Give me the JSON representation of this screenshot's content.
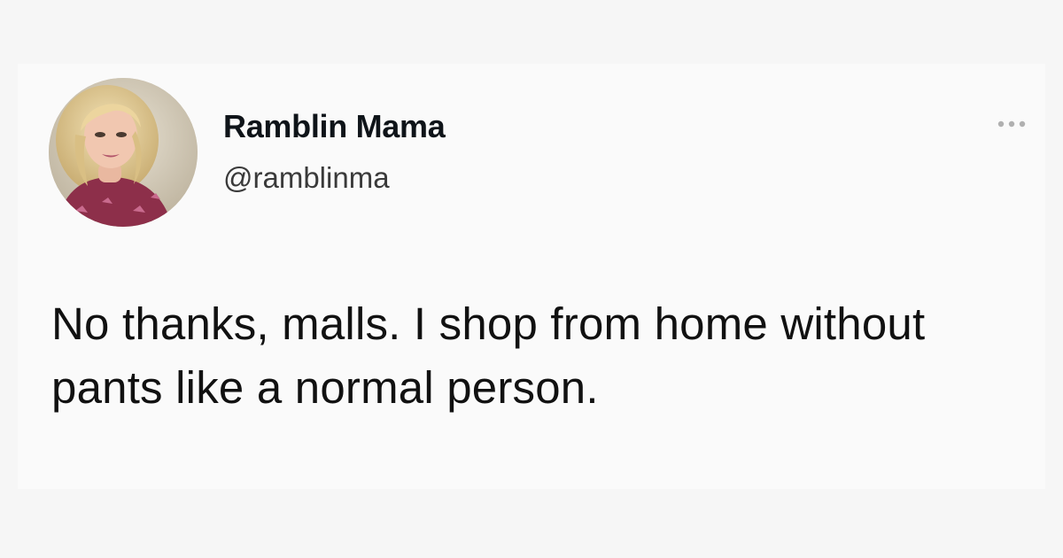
{
  "tweet": {
    "display_name": "Ramblin Mama",
    "handle": "@ramblinma",
    "text": "No thanks, malls. I shop from home without pants like a normal person.",
    "avatar_icon": "user-avatar-photo",
    "menu_icon": "more-options-icon"
  },
  "colors": {
    "background": "#f6f6f6",
    "card": "#fafafa",
    "name": "#0f1419",
    "handle": "#3a3a3a",
    "text": "#111111",
    "menu_dots": "#b0b0b0"
  }
}
